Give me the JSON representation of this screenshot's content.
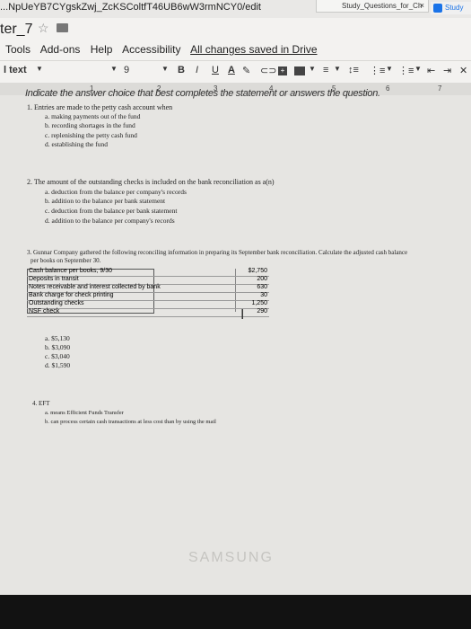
{
  "browser": {
    "url": "...NpUeYB7CYgskZwj_ZcKSColtfT46UB6wW3rmNCY0/edit",
    "tab_label": "Study_Questions_for_Ch",
    "tab_close": "×",
    "tab2_label": "Study"
  },
  "doc": {
    "title": "ter_7",
    "menu": [
      "Tools",
      "Add-ons",
      "Help",
      "Accessibility"
    ],
    "saved_status": "All changes saved in Drive"
  },
  "toolbar": {
    "style": "l text",
    "font_size": "9",
    "bold": "B",
    "italic": "I",
    "underline": "U",
    "text_color": "A"
  },
  "ruler": [
    "1",
    "2",
    "3",
    "4",
    "5",
    "6",
    "7"
  ],
  "content": {
    "instruction": "Indicate the answer choice that best completes the statement or answers the question.",
    "q1": {
      "stem": "1. Entries are made to the petty cash account when",
      "options": [
        "a. making payments out of the fund",
        "b. recording shortages in the fund",
        "c. replenishing the petty cash fund",
        "d. establishing the fund"
      ]
    },
    "q2": {
      "stem": "2. The amount of the outstanding checks is included on the bank reconciliation as a(n)",
      "options": [
        "a. deduction from the balance per company's records",
        "b. addition to the balance per bank statement",
        "c. deduction from the balance per bank statement",
        "d. addition to the balance per company's records"
      ]
    },
    "q3": {
      "stem": "3. Gunnar Company gathered the following reconciling information in preparing its September bank reconciliation. Calculate the adjusted cash balance",
      "stem2": "per books on September 30.",
      "table": [
        {
          "label": "Cash balance per books, 9/30",
          "value": "$2,750"
        },
        {
          "label": "Deposits in transit",
          "value": "200"
        },
        {
          "label": "Notes receivable and interest collected by bank",
          "value": "630"
        },
        {
          "label": "Bank charge for check printing",
          "value": "30"
        },
        {
          "label": "Outstanding checks",
          "value": "1,250"
        },
        {
          "label": "NSF check",
          "value": "290"
        }
      ],
      "options": [
        "a. $5,130",
        "b. $3,090",
        "c. $3,040",
        "d. $1,590"
      ]
    },
    "q4": {
      "stem": "4. EFT",
      "options": [
        "a. means Efficient Funds Transfer",
        "b. can process certain cash transactions at less cost than by using the mail"
      ]
    }
  },
  "bezel": {
    "brand": "SAMSUNG"
  }
}
